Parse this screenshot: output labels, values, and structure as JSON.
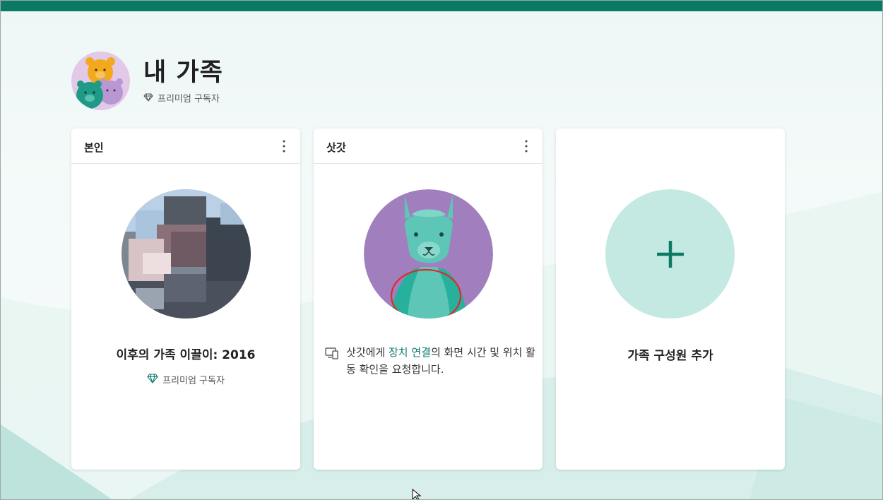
{
  "header": {
    "title": "내 가족",
    "subscription": "프리미엄 구독자"
  },
  "cards": [
    {
      "name": "본인",
      "member_title": "이후의 가족 이끌이: 2016",
      "subscription": "프리미엄 구독자"
    },
    {
      "name": "삿갓",
      "notice_before": "삿갓에게 ",
      "notice_link": "장치 연결",
      "notice_after": "의 화면 시간 및 위치 활동 확인을 요청합니다."
    }
  ],
  "add_member": {
    "label": "가족 구성원 추가"
  },
  "colors": {
    "accent": "#0b7a6b",
    "topbar": "#0b7a64",
    "add_circle": "#c4e8e2",
    "llama_bg": "#a17fbf",
    "llama_body": "#5ec6b6",
    "annotation": "#e0282a"
  },
  "icons": {
    "more": "more-vertical-icon",
    "premium": "diamond-icon",
    "device": "device-link-icon",
    "add": "plus-icon"
  }
}
